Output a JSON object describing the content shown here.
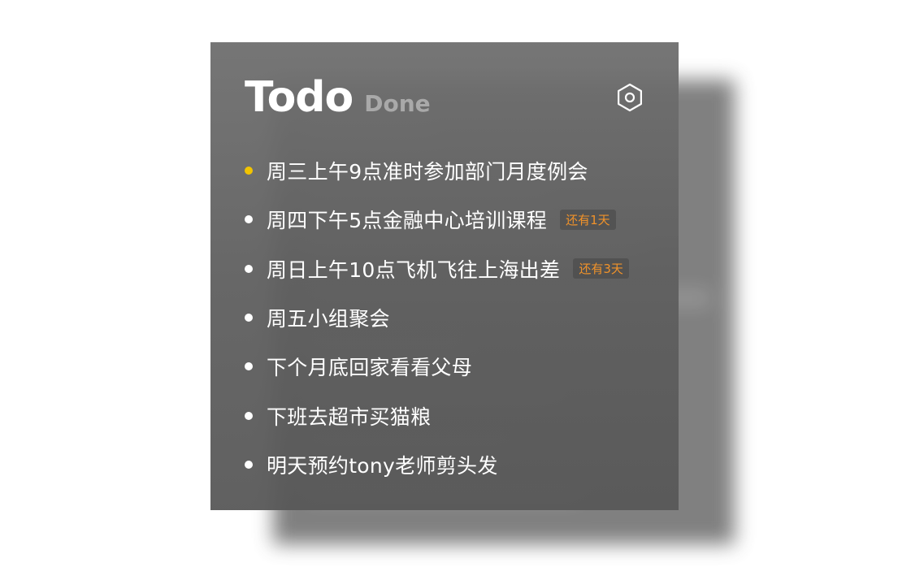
{
  "header": {
    "title": "Todo",
    "tab_done": "Done"
  },
  "settings": {
    "icon": "gear-icon"
  },
  "colors": {
    "accent_dot": "#f2c400",
    "badge_text": "#f0922a",
    "panel_bg": "#666666",
    "done_tab": "#a9a9a9"
  },
  "todos": [
    {
      "text": "周三上午9点准时参加部门月度例会",
      "badge": "",
      "highlight": true
    },
    {
      "text": "周四下午5点金融中心培训课程",
      "badge": "还有1天",
      "highlight": false
    },
    {
      "text": "周日上午10点飞机飞往上海出差",
      "badge": "还有3天",
      "highlight": false
    },
    {
      "text": "周五小组聚会",
      "badge": "",
      "highlight": false
    },
    {
      "text": "下个月底回家看看父母",
      "badge": "",
      "highlight": false
    },
    {
      "text": "下班去超市买猫粮",
      "badge": "",
      "highlight": false
    },
    {
      "text": "明天预约tony老师剪头发",
      "badge": "",
      "highlight": false
    }
  ]
}
